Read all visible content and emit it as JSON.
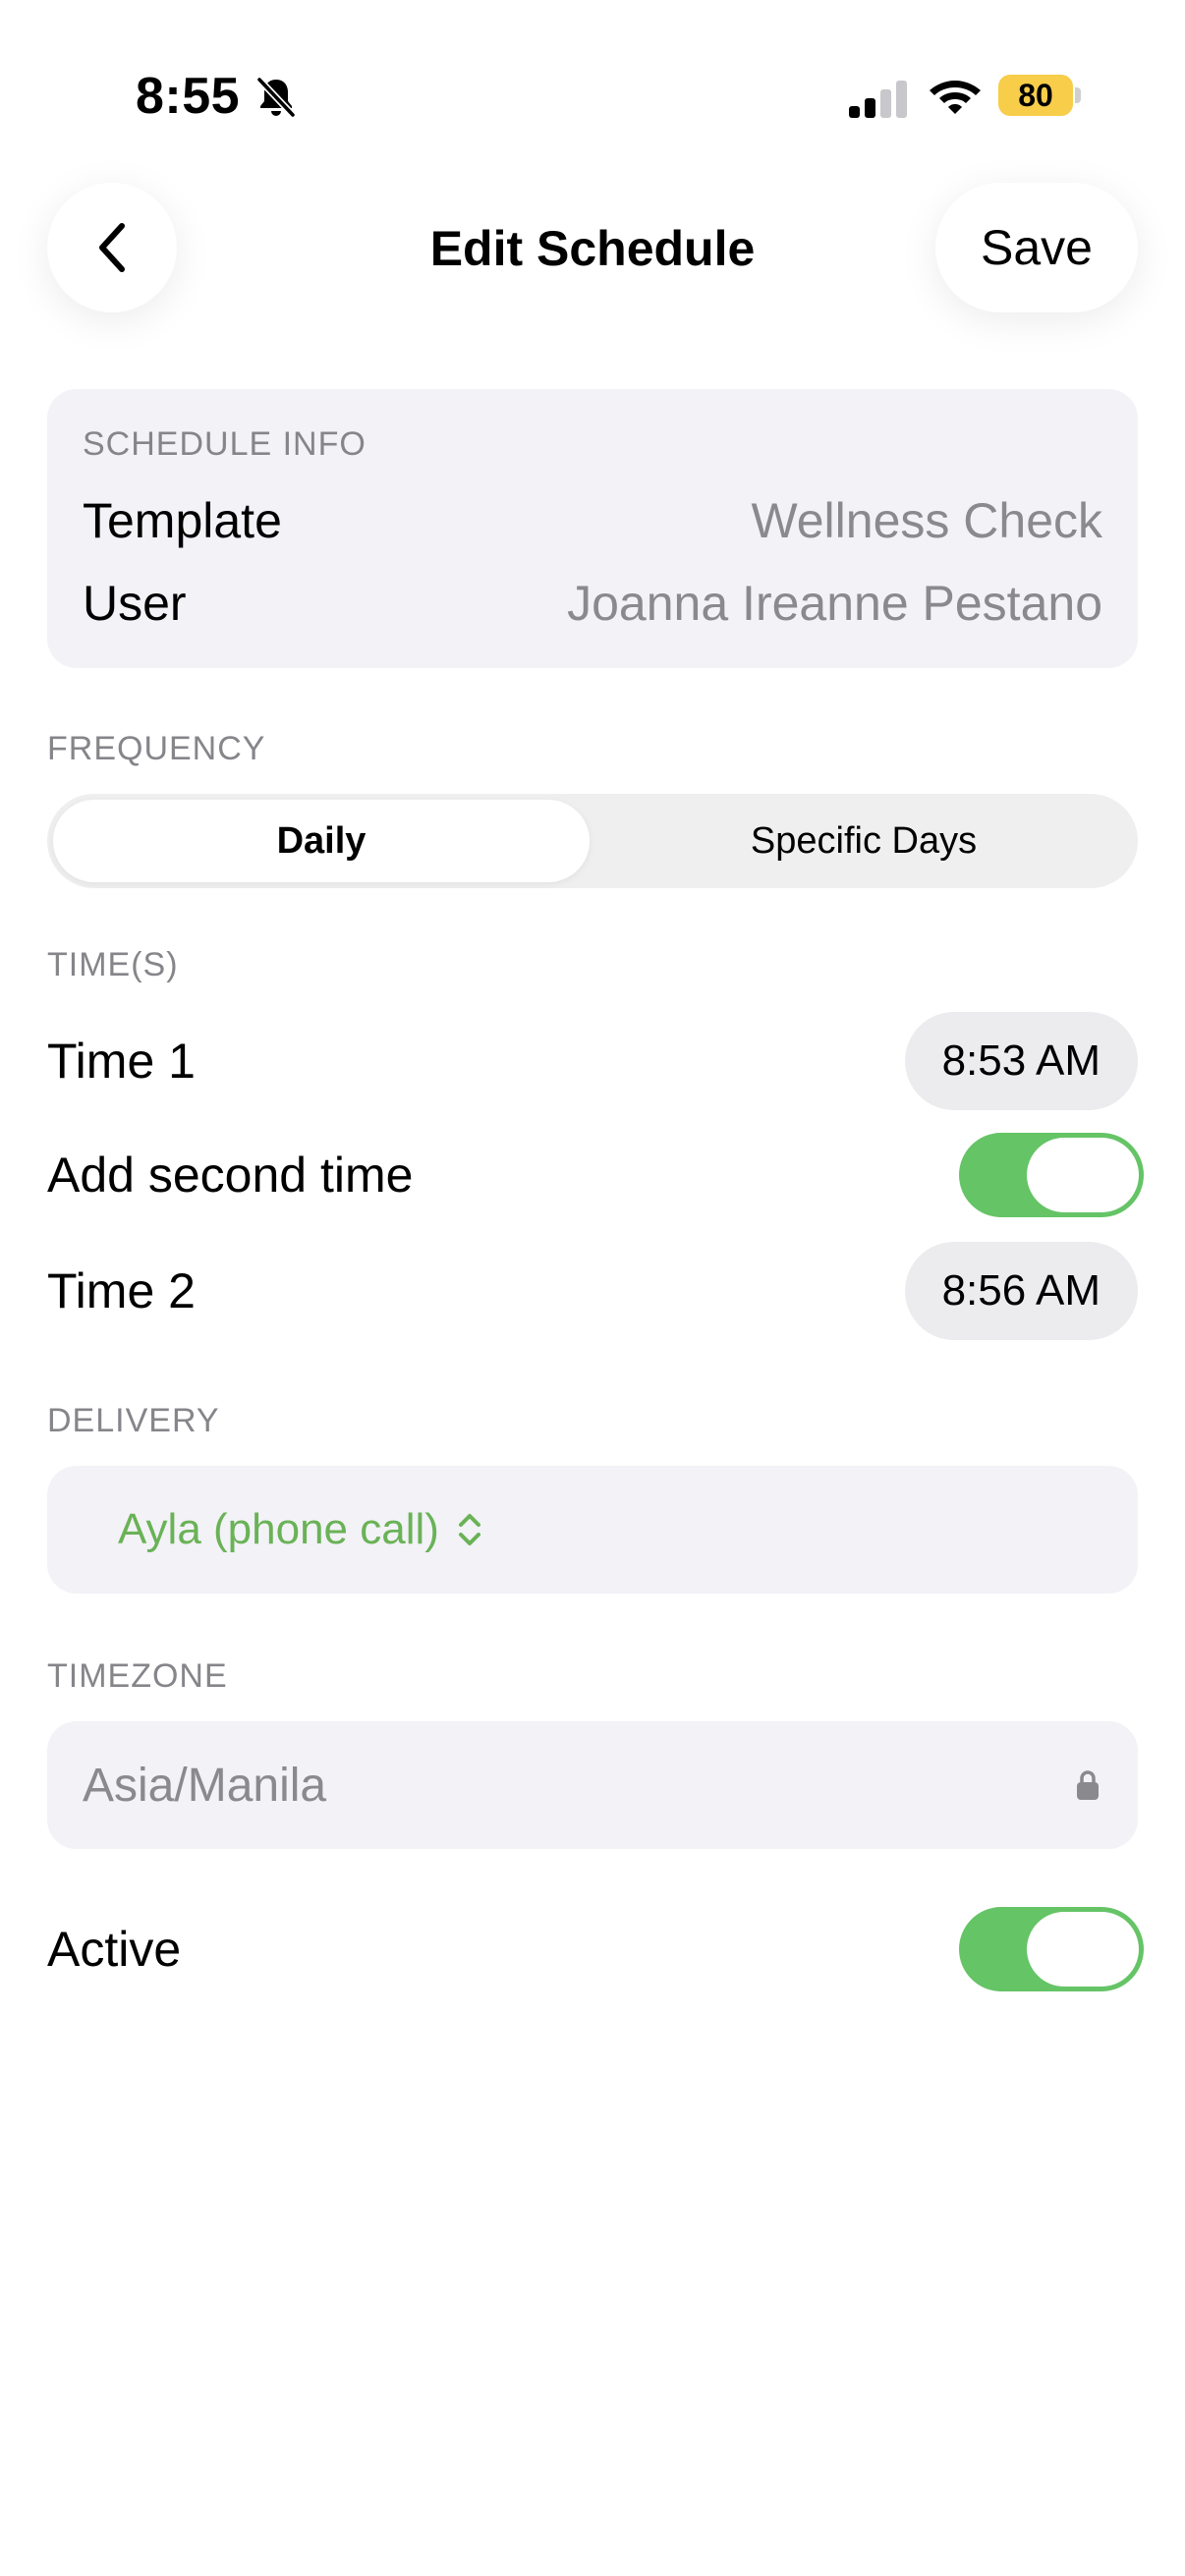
{
  "status_bar": {
    "time": "8:55",
    "battery": "80"
  },
  "nav": {
    "title": "Edit Schedule",
    "save_label": "Save"
  },
  "schedule_info": {
    "header": "SCHEDULE INFO",
    "rows": [
      {
        "label": "Template",
        "value": "Wellness Check"
      },
      {
        "label": "User",
        "value": "Joanna Ireanne Pestano"
      }
    ]
  },
  "frequency": {
    "header": "FREQUENCY",
    "options": [
      "Daily",
      "Specific Days"
    ],
    "selected": "Daily"
  },
  "times": {
    "header": "TIME(S)",
    "time1_label": "Time 1",
    "time1_value": "8:53 AM",
    "second_time_label": "Add second time",
    "second_time_enabled": true,
    "time2_label": "Time 2",
    "time2_value": "8:56 AM"
  },
  "delivery": {
    "header": "DELIVERY",
    "value": "Ayla (phone call)"
  },
  "timezone": {
    "header": "TIMEZONE",
    "value": "Asia/Manila"
  },
  "active": {
    "label": "Active",
    "enabled": true
  },
  "colors": {
    "accent_green": "#65c466",
    "delivery_text": "#6ab256",
    "battery": "#f7cd4a",
    "secondary_text": "#8a8a8e",
    "card_bg": "#f2f2f7"
  }
}
